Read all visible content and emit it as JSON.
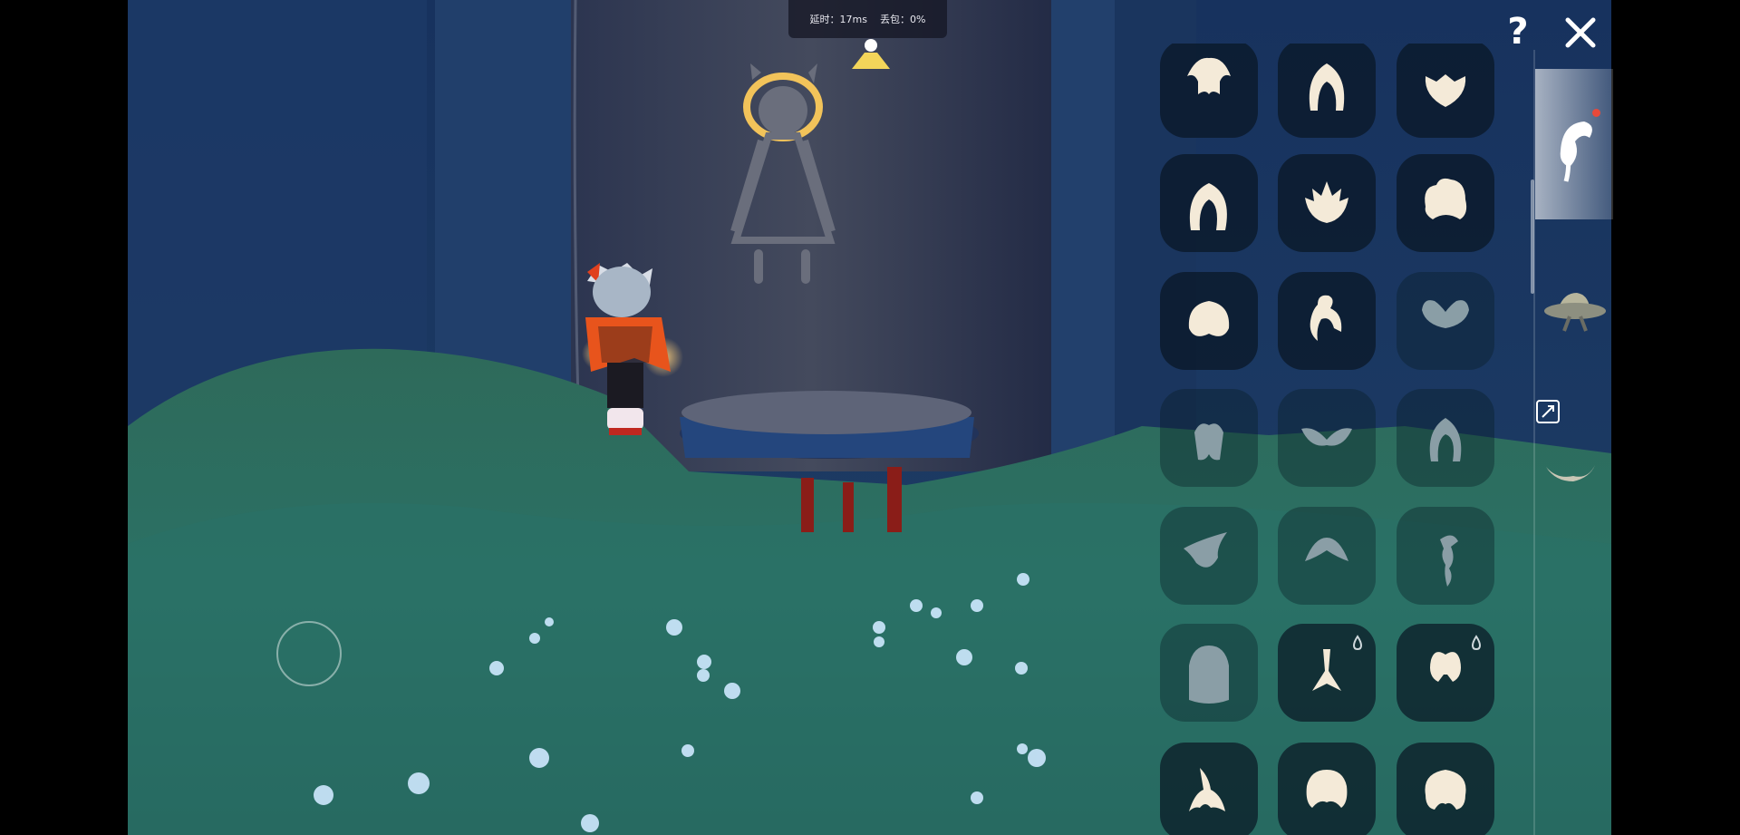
{
  "hud": {
    "latency_label": "延时：17ms",
    "packet_loss_label": "丢包：0%"
  },
  "controls": {
    "help_label": "?",
    "close_icon": "close-x-icon"
  },
  "closet": {
    "category_tabs": [
      {
        "name": "hair-tab",
        "icon": "hair-icon",
        "selected": true,
        "has_notification": true
      },
      {
        "name": "hat-tab",
        "icon": "hat-icon",
        "selected": false
      },
      {
        "name": "expand-toggle",
        "icon": "expand-icon",
        "selected": false
      },
      {
        "name": "horn-tab",
        "icon": "horn-icon",
        "selected": false
      }
    ],
    "hair_items": [
      {
        "icon": "wavy-bob-hair-icon",
        "owned": true
      },
      {
        "icon": "long-straight-hair-icon",
        "owned": true
      },
      {
        "icon": "short-bun-hair-icon",
        "owned": true
      },
      {
        "icon": "long-braid-hair-icon",
        "owned": true
      },
      {
        "icon": "spiky-hair-icon",
        "owned": true
      },
      {
        "icon": "curly-fluffy-hair-icon",
        "owned": true
      },
      {
        "icon": "afro-puff-hair-icon",
        "owned": true
      },
      {
        "icon": "top-bun-hair-icon",
        "owned": true
      },
      {
        "icon": "double-buns-hair-icon",
        "owned": false
      },
      {
        "icon": "parted-bob-hair-icon",
        "owned": false
      },
      {
        "icon": "winged-hair-icon",
        "owned": false
      },
      {
        "icon": "long-wavy-hair-icon",
        "owned": false
      },
      {
        "icon": "swept-bangs-hair-icon",
        "owned": false
      },
      {
        "icon": "pointed-cap-hair-icon",
        "owned": false
      },
      {
        "icon": "side-braid-hair-icon",
        "owned": false
      },
      {
        "icon": "hooded-veil-hair-icon",
        "owned": false
      },
      {
        "icon": "ponytail-hair-icon",
        "owned": true,
        "candle_cost_icon": true
      },
      {
        "icon": "bow-twintail-hair-icon",
        "owned": true,
        "candle_cost_icon": true
      },
      {
        "icon": "flared-hair-icon",
        "owned": true
      },
      {
        "icon": "ribbon-bob-hair-icon",
        "owned": true
      },
      {
        "icon": "curly-bob-hair-icon",
        "owned": true
      }
    ]
  },
  "world": {
    "spirit_icon": "ancestor-spirit-silhouette-icon",
    "player": "player-avatar",
    "joystick": "movement-joystick"
  },
  "colors": {
    "sky_blue": "#1a3560",
    "grass": "#2f6f66",
    "hair_icon_owned": "#f4ead8",
    "hair_icon_locked": "#8a9ea6",
    "player_cape": "#e8541c",
    "spirit_outline": "#f2c35a"
  }
}
